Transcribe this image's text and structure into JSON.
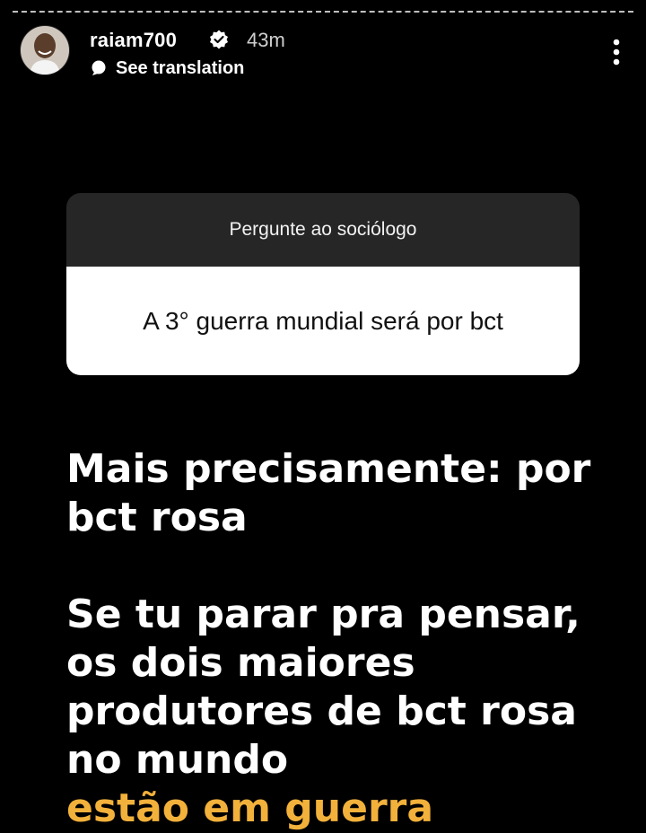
{
  "story": {
    "username": "raiam700",
    "timestamp": "43m",
    "translate_label": "See translation",
    "verified": true
  },
  "question_sticker": {
    "prompt": "Pergunte ao sociólogo",
    "answer": "A 3° guerra mundial será por bct"
  },
  "caption": {
    "line1": "Mais precisamente: por bct rosa",
    "line2_main": "Se tu parar pra pensar, os dois maiores produtores de bct rosa no mundo",
    "line2_highlight": "estão em guerra"
  },
  "colors": {
    "background": "#000000",
    "highlight": "#f2b13b",
    "card_header": "#262626"
  },
  "icons": [
    "verified-badge-icon",
    "translate-icon",
    "more-options-icon"
  ]
}
